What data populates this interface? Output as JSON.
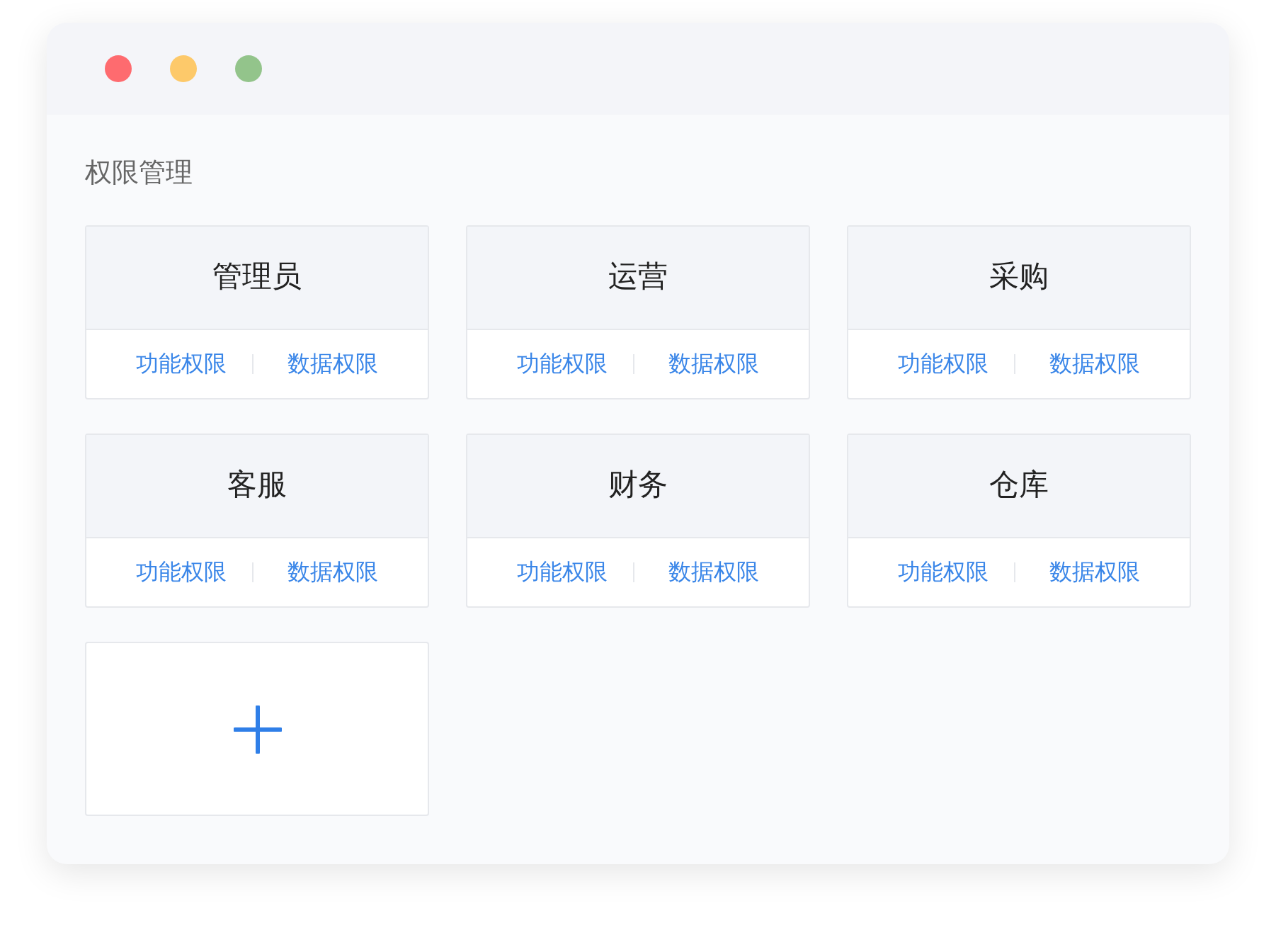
{
  "window_controls": [
    {
      "color": "#fe6b6f"
    },
    {
      "color": "#fdc96a"
    },
    {
      "color": "#93c48b"
    }
  ],
  "title": "权限管理",
  "roles": [
    {
      "name": "管理员",
      "links": [
        "功能权限",
        "数据权限"
      ]
    },
    {
      "name": "运营",
      "links": [
        "功能权限",
        "数据权限"
      ]
    },
    {
      "name": "采购",
      "links": [
        "功能权限",
        "数据权限"
      ]
    },
    {
      "name": "客服",
      "links": [
        "功能权限",
        "数据权限"
      ]
    },
    {
      "name": "财务",
      "links": [
        "功能权限",
        "数据权限"
      ]
    },
    {
      "name": "仓库",
      "links": [
        "功能权限",
        "数据权限"
      ]
    }
  ]
}
